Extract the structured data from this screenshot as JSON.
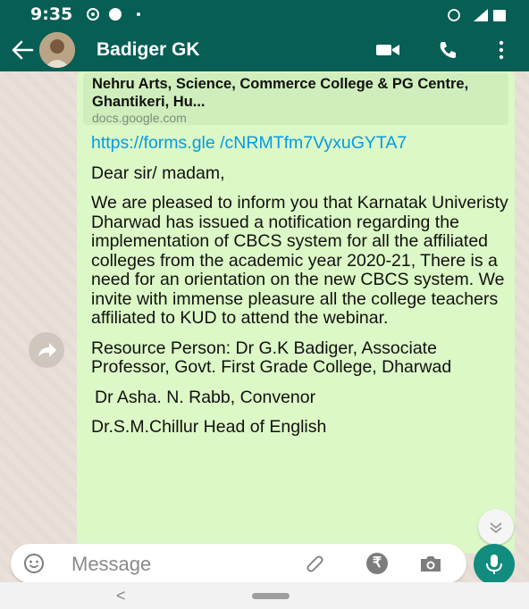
{
  "status_bar": {
    "time": "9:35"
  },
  "app_bar": {
    "contact_name": "Badiger GK",
    "icons": [
      "back-arrow-icon",
      "avatar",
      "video-call-icon",
      "voice-call-icon",
      "more-options-icon"
    ]
  },
  "link_preview": {
    "title": "Nehru Arts, Science, Commerce College & PG Centre, Ghantikeri, Hu...",
    "domain": "docs.google.com"
  },
  "message": {
    "link": "https://forms.gle /cNRMTfm7VyxuGYTA7",
    "greeting": "Dear sir/ madam,",
    "body": "We are pleased to inform you that Karnatak Univeristy Dharwad has issued a notification regarding the implementation of CBCS system for all the affiliated colleges from the academic year 2020-21, There is a need for an orientation on the new CBCS system. We invite with immense pleasure all the college teachers affiliated to KUD to attend the webinar.",
    "resource_person": "Resource Person: Dr G.K Badiger, Associate Professor, Govt. First Grade College, Dharwad",
    "convenor": "Dr Asha. N. Rabb, Convenor",
    "head": "Dr.S.M.Chillur Head of English"
  },
  "composer": {
    "placeholder": "Message",
    "rupee_symbol": "₹"
  },
  "colors": {
    "header": "#075E54",
    "bubble": "#dcf8c6",
    "link": "#039be5",
    "mic_button": "#128C7E"
  }
}
